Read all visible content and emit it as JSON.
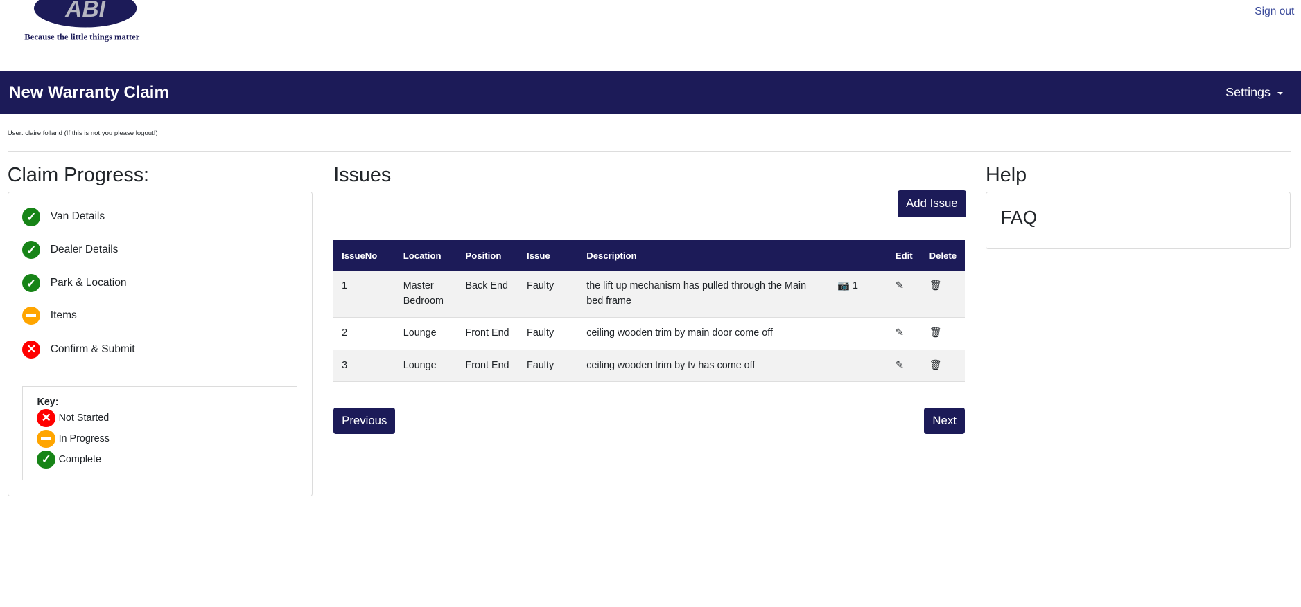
{
  "header": {
    "logo_text": "ABI",
    "tagline": "Because the little things matter",
    "sign_out": "Sign out"
  },
  "navbar": {
    "title": "New Warranty Claim",
    "settings": "Settings"
  },
  "user_line": "User: claire.folland (If this is not you please logout!)",
  "progress": {
    "heading": "Claim Progress:",
    "steps": [
      {
        "label": "Van Details",
        "status": "complete"
      },
      {
        "label": "Dealer Details",
        "status": "complete"
      },
      {
        "label": "Park & Location",
        "status": "complete"
      },
      {
        "label": "Items",
        "status": "in-progress"
      },
      {
        "label": "Confirm & Submit",
        "status": "not-started"
      }
    ],
    "key": {
      "title": "Key:",
      "not_started": "Not Started",
      "in_progress": "In Progress",
      "complete": "Complete"
    }
  },
  "issues": {
    "heading": "Issues",
    "add_button": "Add Issue",
    "columns": [
      "IssueNo",
      "Location",
      "Position",
      "Issue",
      "Description",
      "",
      "Edit",
      "Delete"
    ],
    "rows": [
      {
        "no": "1",
        "location": "Master Bedroom",
        "position": "Back End",
        "issue": "Faulty",
        "description": "the lift up mechanism has pulled through the Main bed frame",
        "photos": "1"
      },
      {
        "no": "2",
        "location": "Lounge",
        "position": "Front End",
        "issue": "Faulty",
        "description": "ceiling wooden trim by main door come off",
        "photos": ""
      },
      {
        "no": "3",
        "location": "Lounge",
        "position": "Front End",
        "issue": "Faulty",
        "description": "ceiling wooden trim by tv has come off",
        "photos": ""
      }
    ],
    "previous": "Previous",
    "next": "Next"
  },
  "help": {
    "heading": "Help",
    "faq": "FAQ"
  },
  "colors": {
    "brand": "#1c1b58",
    "complete": "#178417",
    "in_progress": "#ffa500",
    "not_started": "#ff0000"
  }
}
